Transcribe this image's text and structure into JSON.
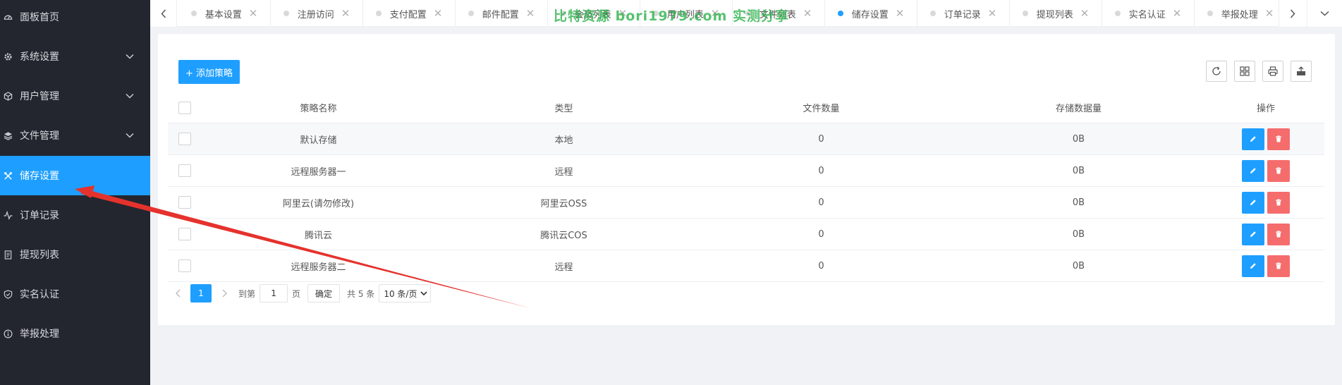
{
  "sidebar": {
    "items": [
      {
        "label": "面板首页",
        "icon": "dashboard-icon",
        "expandable": false
      },
      {
        "label": "系统设置",
        "icon": "gear-icon",
        "expandable": true
      },
      {
        "label": "用户管理",
        "icon": "box-icon",
        "expandable": true
      },
      {
        "label": "文件管理",
        "icon": "layers-icon",
        "expandable": true
      },
      {
        "label": "储存设置",
        "icon": "tools-icon",
        "expandable": false,
        "active": true
      },
      {
        "label": "订单记录",
        "icon": "activity-icon",
        "expandable": false
      },
      {
        "label": "提现列表",
        "icon": "document-icon",
        "expandable": false
      },
      {
        "label": "实名认证",
        "icon": "shield-icon",
        "expandable": false
      },
      {
        "label": "举报处理",
        "icon": "info-icon",
        "expandable": false
      }
    ]
  },
  "tabs": [
    {
      "label": "基本设置"
    },
    {
      "label": "注册访问"
    },
    {
      "label": "支付配置"
    },
    {
      "label": "邮件配置"
    },
    {
      "label": "会员列表"
    },
    {
      "label": "用户列表"
    },
    {
      "label": "文件列表"
    },
    {
      "label": "储存设置",
      "active": true
    },
    {
      "label": "订单记录"
    },
    {
      "label": "提现列表"
    },
    {
      "label": "实名认证"
    },
    {
      "label": "举报处理"
    }
  ],
  "watermark": "比特资源 bori1979.com 实测分享",
  "toolbar": {
    "add_label": "+ 添加策略"
  },
  "table": {
    "headers": {
      "name": "策略名称",
      "type": "类型",
      "count": "文件数量",
      "size": "存储数据量",
      "ops": "操作"
    },
    "rows": [
      {
        "name": "默认存储",
        "type": "本地",
        "count": "0",
        "size": "0B"
      },
      {
        "name": "远程服务器一",
        "type": "远程",
        "count": "0",
        "size": "0B"
      },
      {
        "name": "阿里云(请勿修改)",
        "type": "阿里云OSS",
        "count": "0",
        "size": "0B"
      },
      {
        "name": "腾讯云",
        "type": "腾讯云COS",
        "count": "0",
        "size": "0B"
      },
      {
        "name": "远程服务器二",
        "type": "远程",
        "count": "0",
        "size": "0B"
      }
    ]
  },
  "pagination": {
    "current": "1",
    "goto_label": "到第",
    "input_value": "1",
    "page_unit": "页",
    "confirm": "确定",
    "total": "共 5 条",
    "page_size": "10 条/页"
  },
  "colors": {
    "sidebar_bg": "#23262e",
    "accent": "#1e9fff",
    "danger": "#f56c6c",
    "annotation_arrow": "#e5322d"
  }
}
